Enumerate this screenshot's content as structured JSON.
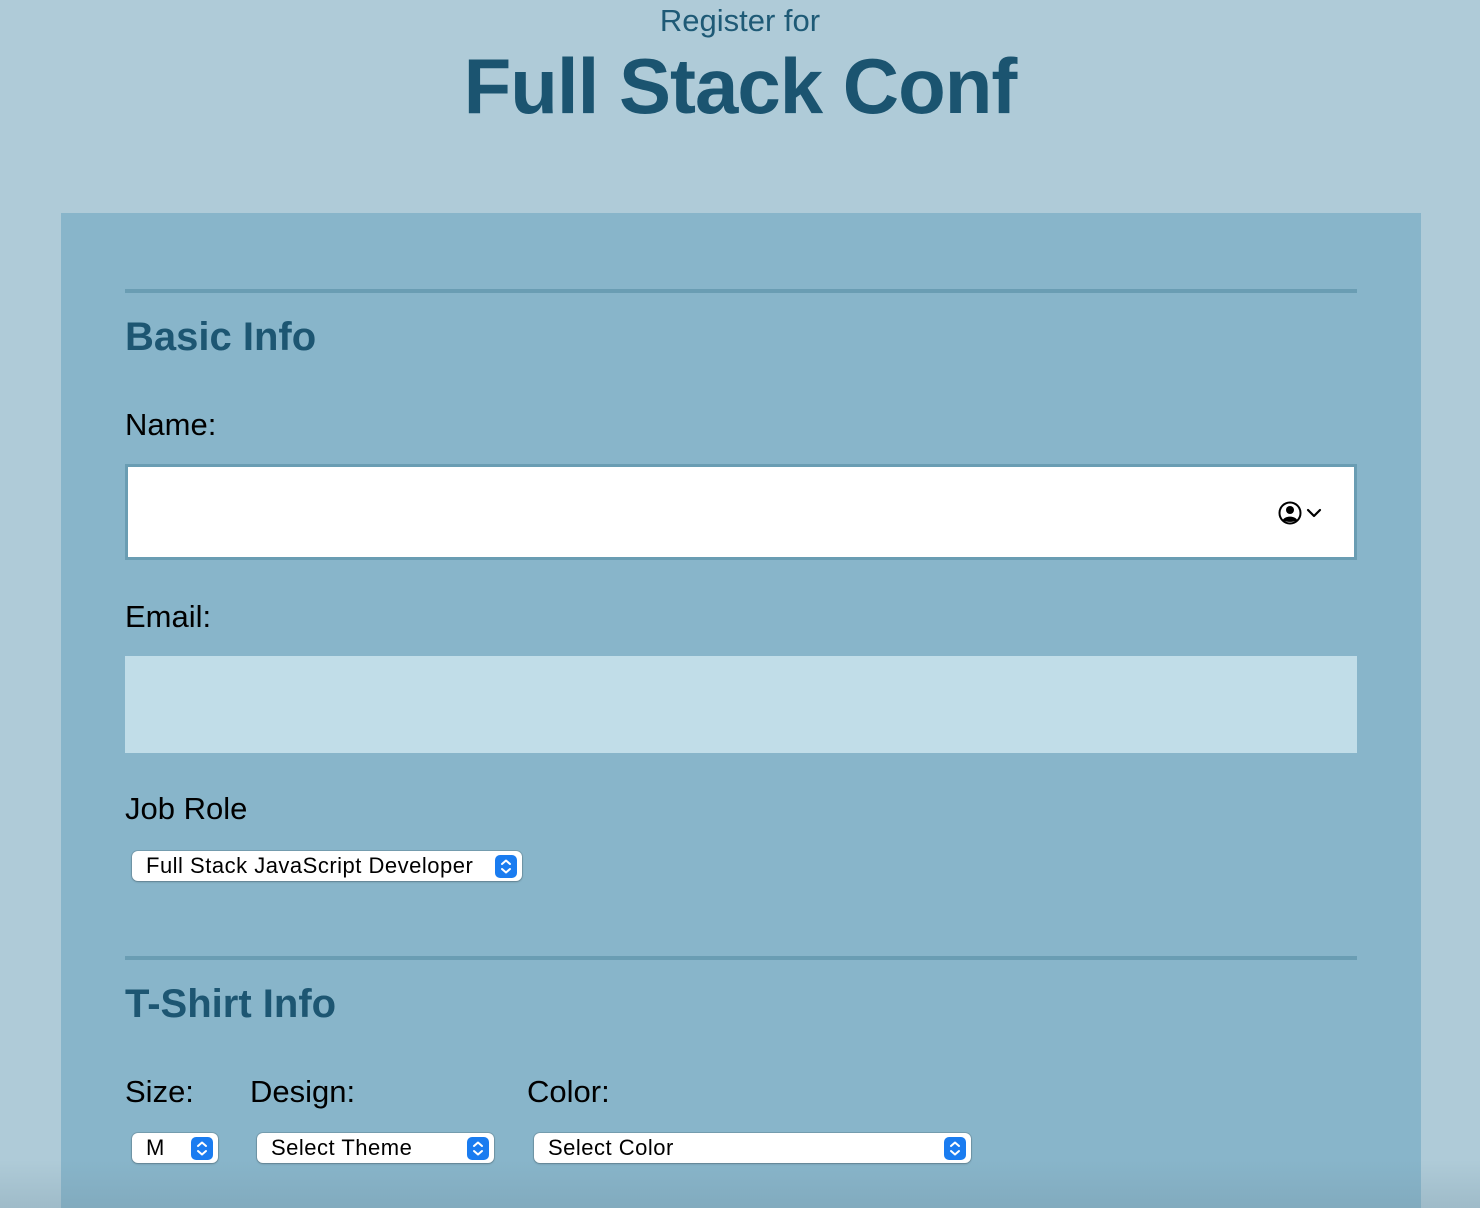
{
  "header": {
    "pre_title": "Register for",
    "title": "Full Stack Conf"
  },
  "basic_info": {
    "heading": "Basic Info",
    "name_label": "Name:",
    "name_value": "",
    "email_label": "Email:",
    "email_value": "",
    "job_role_label": "Job Role",
    "job_role_selected": "Full Stack JavaScript Developer"
  },
  "tshirt_info": {
    "heading": "T-Shirt Info",
    "size_label": "Size:",
    "size_selected": "M",
    "design_label": "Design:",
    "design_selected": "Select Theme",
    "color_label": "Color:",
    "color_selected": "Select Color"
  },
  "colors": {
    "page_background": "#afcbd8",
    "form_background": "#88b5ca",
    "heading_color": "#1b5470",
    "email_field_background": "#c1dde8",
    "select_arrow_accent": "#1a7cf0"
  },
  "icons": {
    "name_autofill": "contact-autofill-icon",
    "select_arrow": "updown-chevron-icon"
  }
}
